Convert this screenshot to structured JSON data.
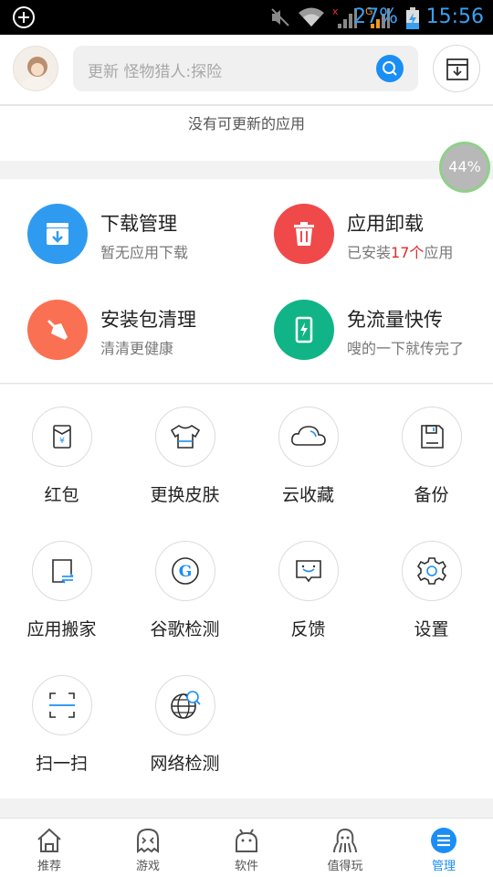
{
  "status_bar": {
    "battery": "27%",
    "time": "15:56",
    "accent_color": "#3aa0f0"
  },
  "header": {
    "search_placeholder": "更新 怪物猎人:探险",
    "icons": [
      "avatar",
      "search-icon",
      "download-manager-icon"
    ]
  },
  "update_status": "没有可更新的应用",
  "memory_ball": "44%",
  "features": [
    {
      "title": "下载管理",
      "subtitle": "暂无应用下载",
      "color": "#2f9bf0",
      "icon": "download-icon"
    },
    {
      "title": "应用卸载",
      "subtitle_prefix": "已安装",
      "subtitle_count": "17个",
      "subtitle_suffix": "应用",
      "color": "#f0494a",
      "icon": "trash-icon"
    },
    {
      "title": "安装包清理",
      "subtitle": "清清更健康",
      "color": "#fa7052",
      "icon": "broom-icon"
    },
    {
      "title": "免流量快传",
      "subtitle": "嗖的一下就传完了",
      "color": "#11b486",
      "icon": "phone-bolt-icon"
    }
  ],
  "tools": [
    {
      "label": "红包",
      "icon": "red-envelope-icon"
    },
    {
      "label": "更换皮肤",
      "icon": "tshirt-icon"
    },
    {
      "label": "云收藏",
      "icon": "cloud-icon"
    },
    {
      "label": "备份",
      "icon": "floppy-icon"
    },
    {
      "label": "应用搬家",
      "icon": "transfer-icon"
    },
    {
      "label": "谷歌检测",
      "icon": "google-icon"
    },
    {
      "label": "反馈",
      "icon": "feedback-icon"
    },
    {
      "label": "设置",
      "icon": "gear-icon"
    },
    {
      "label": "扫一扫",
      "icon": "scan-icon"
    },
    {
      "label": "网络检测",
      "icon": "globe-search-icon"
    }
  ],
  "bottom_nav": [
    {
      "label": "推荐",
      "icon": "home-icon",
      "active": false
    },
    {
      "label": "游戏",
      "icon": "ghost-icon",
      "active": false
    },
    {
      "label": "软件",
      "icon": "android-icon",
      "active": false
    },
    {
      "label": "值得玩",
      "icon": "octopus-icon",
      "active": false
    },
    {
      "label": "管理",
      "icon": "manage-icon",
      "active": true
    }
  ],
  "colors": {
    "brand_blue": "#1a8ef5",
    "count_red": "#e02a2a"
  }
}
